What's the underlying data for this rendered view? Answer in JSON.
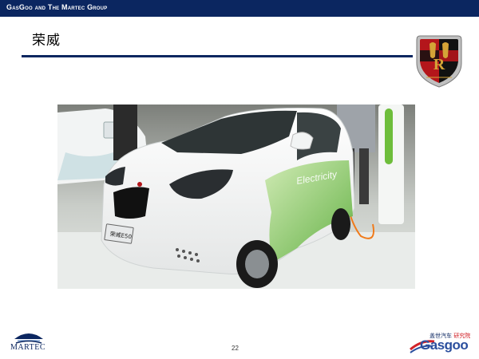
{
  "header": {
    "company_line": "GasGoo and The Martec Group"
  },
  "slide": {
    "title": "荣威",
    "car_plate": "荣威E50",
    "car_side_text": "Electricity"
  },
  "footer": {
    "page_number": "22",
    "left_logo_text": "MARTEC",
    "right_logo_cn_a": "盖世汽车",
    "right_logo_cn_b": "研究院",
    "right_logo_word": "Gasgoo"
  },
  "colors": {
    "navy": "#0b2660",
    "badge_red": "#b4161b",
    "badge_black": "#111111",
    "badge_gold": "#d4a437",
    "car_green": "#6dbd3a",
    "gasgoo_red": "#d2232a",
    "gasgoo_blue": "#2b4f9e"
  },
  "icons": {
    "brand_badge": "roewe-lion-shield-icon",
    "martec": "martec-ship-icon",
    "gasgoo": "gasgoo-swoosh-icon"
  }
}
